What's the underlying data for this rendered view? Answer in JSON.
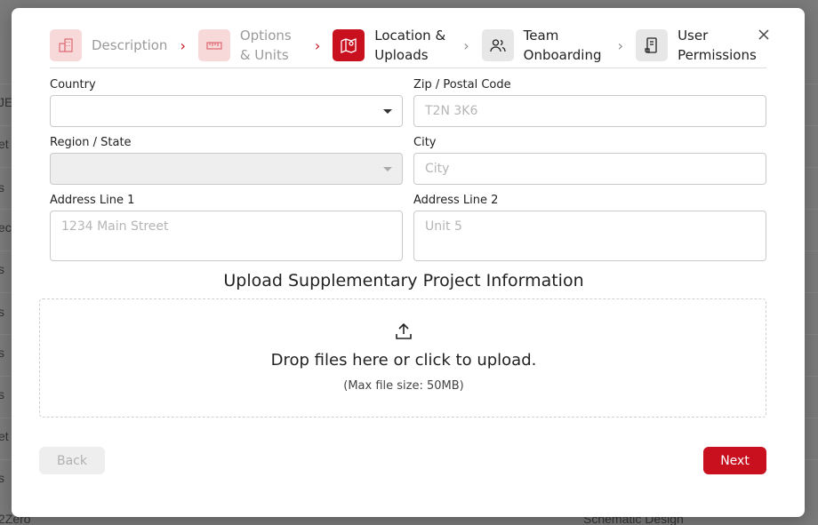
{
  "background": {
    "row_fragments": [
      "JE",
      "et",
      "s",
      "ec",
      "s",
      "s",
      "s",
      "s",
      "et",
      "s"
    ],
    "bottom_left": "2Zero",
    "bottom_right": "Schematic Design"
  },
  "stepper": {
    "steps": [
      {
        "label": "Description",
        "state": "done",
        "icon": "building-icon"
      },
      {
        "label": "Options & Units",
        "state": "done",
        "icon": "ruler-icon"
      },
      {
        "label": "Location & Uploads",
        "state": "active",
        "icon": "map-icon"
      },
      {
        "label": "Team Onboarding",
        "state": "todo",
        "icon": "users-icon"
      },
      {
        "label": "User Permissions",
        "state": "todo",
        "icon": "document-icon"
      }
    ]
  },
  "form": {
    "country": {
      "label": "Country",
      "value": ""
    },
    "zip": {
      "label": "Zip / Postal Code",
      "placeholder": "T2N 3K6"
    },
    "region": {
      "label": "Region / State",
      "value": ""
    },
    "city": {
      "label": "City",
      "placeholder": "City"
    },
    "address1": {
      "label": "Address Line 1",
      "placeholder": "1234 Main Street"
    },
    "address2": {
      "label": "Address Line 2",
      "placeholder": "Unit 5"
    }
  },
  "upload": {
    "title": "Upload Supplementary Project Information",
    "drop_text": "Drop files here or click to upload.",
    "max_size": "(Max file size: 50MB)"
  },
  "footer": {
    "back_label": "Back",
    "next_label": "Next"
  },
  "colors": {
    "accent": "#c8101e",
    "done_bg": "#f8d9da",
    "todo_bg": "#e7e7e7"
  }
}
